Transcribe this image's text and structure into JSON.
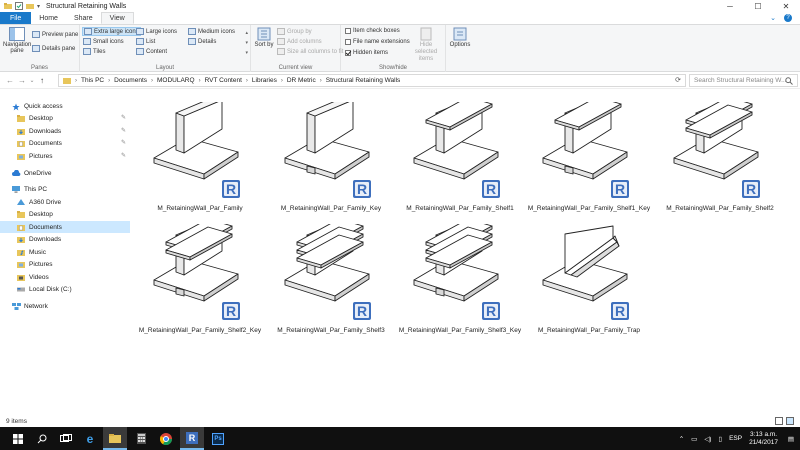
{
  "window": {
    "title": "Structural Retaining Walls",
    "controls": {
      "minimize": "─",
      "maximize": "☐",
      "close": "✕"
    },
    "dropdown_arrow": "▾"
  },
  "ribbon_tabs": [
    "File",
    "Home",
    "Share",
    "View"
  ],
  "ribbon": {
    "panes": {
      "label": "Panes",
      "navigation_pane": "Navigation pane",
      "preview_pane": "Preview pane",
      "details_pane": "Details pane"
    },
    "layout": {
      "label": "Layout",
      "extra_large_icons": "Extra large icons",
      "large_icons": "Large icons",
      "medium_icons": "Medium icons",
      "small_icons": "Small icons",
      "list": "List",
      "details": "Details",
      "tiles": "Tiles",
      "content": "Content"
    },
    "current_view": {
      "label": "Current view",
      "sort_by": "Sort by",
      "group_by": "Group by",
      "add_columns": "Add columns",
      "size_all_columns": "Size all columns to fit"
    },
    "show_hide": {
      "label": "Show/hide",
      "item_check_boxes": "Item check boxes",
      "file_name_extensions": "File name extensions",
      "hidden_items": "Hidden items",
      "hide_selected_items": "Hide selected items",
      "options": "Options"
    }
  },
  "address": {
    "crumbs": [
      "This PC",
      "Documents",
      "MODULARQ",
      "RVT Content",
      "Libraries",
      "DR Metric",
      "Structural Retaining Walls"
    ],
    "search_placeholder": "Search Structural Retaining W..."
  },
  "nav": {
    "items": [
      {
        "label": "Quick access",
        "icon": "star-icon",
        "level": 0
      },
      {
        "label": "Desktop",
        "icon": "folder-icon",
        "level": 1,
        "pinned": true
      },
      {
        "label": "Downloads",
        "icon": "download-folder-icon",
        "level": 1,
        "pinned": true
      },
      {
        "label": "Documents",
        "icon": "documents-folder-icon",
        "level": 1,
        "pinned": true
      },
      {
        "label": "Pictures",
        "icon": "pictures-folder-icon",
        "level": 1,
        "pinned": true
      },
      {
        "label": "OneDrive",
        "icon": "cloud-icon",
        "level": 0
      },
      {
        "label": "This PC",
        "icon": "computer-icon",
        "level": 0
      },
      {
        "label": "A360 Drive",
        "icon": "a360-icon",
        "level": 1
      },
      {
        "label": "Desktop",
        "icon": "folder-icon",
        "level": 1
      },
      {
        "label": "Documents",
        "icon": "documents-folder-icon",
        "level": 1,
        "selected": true
      },
      {
        "label": "Downloads",
        "icon": "download-folder-icon",
        "level": 1
      },
      {
        "label": "Music",
        "icon": "music-folder-icon",
        "level": 1
      },
      {
        "label": "Pictures",
        "icon": "pictures-folder-icon",
        "level": 1
      },
      {
        "label": "Videos",
        "icon": "videos-folder-icon",
        "level": 1
      },
      {
        "label": "Local Disk (C:)",
        "icon": "disk-icon",
        "level": 1
      },
      {
        "label": "Network",
        "icon": "network-icon",
        "level": 0
      }
    ]
  },
  "files": [
    {
      "name": "M_RetainingWall_Par_Family",
      "shelves": 0,
      "key": false
    },
    {
      "name": "M_RetainingWall_Par_Family_Key",
      "shelves": 0,
      "key": true
    },
    {
      "name": "M_RetainingWall_Par_Family_Shelf1",
      "shelves": 1,
      "key": false
    },
    {
      "name": "M_RetainingWall_Par_Family_Shelf1_Key",
      "shelves": 1,
      "key": true
    },
    {
      "name": "M_RetainingWall_Par_Family_Shelf2",
      "shelves": 2,
      "key": false
    },
    {
      "name": "M_RetainingWall_Par_Family_Shelf2_Key",
      "shelves": 2,
      "key": true
    },
    {
      "name": "M_RetainingWall_Par_Family_Shelf3",
      "shelves": 3,
      "key": false
    },
    {
      "name": "M_RetainingWall_Par_Family_Shelf3_Key",
      "shelves": 3,
      "key": true
    },
    {
      "name": "M_RetainingWall_Par_Family_Trap",
      "shelves": 0,
      "key": false
    }
  ],
  "revit_badge": "R",
  "status": {
    "item_count": "9 items"
  },
  "taskbar": {
    "language": "ESP",
    "time": "3:13 a.m.",
    "date": "21/4/2017"
  },
  "colors": {
    "accent": "#1979ca",
    "selection": "#cce8ff",
    "folder": "#e8c65b",
    "revit": "#3e6fbd"
  }
}
